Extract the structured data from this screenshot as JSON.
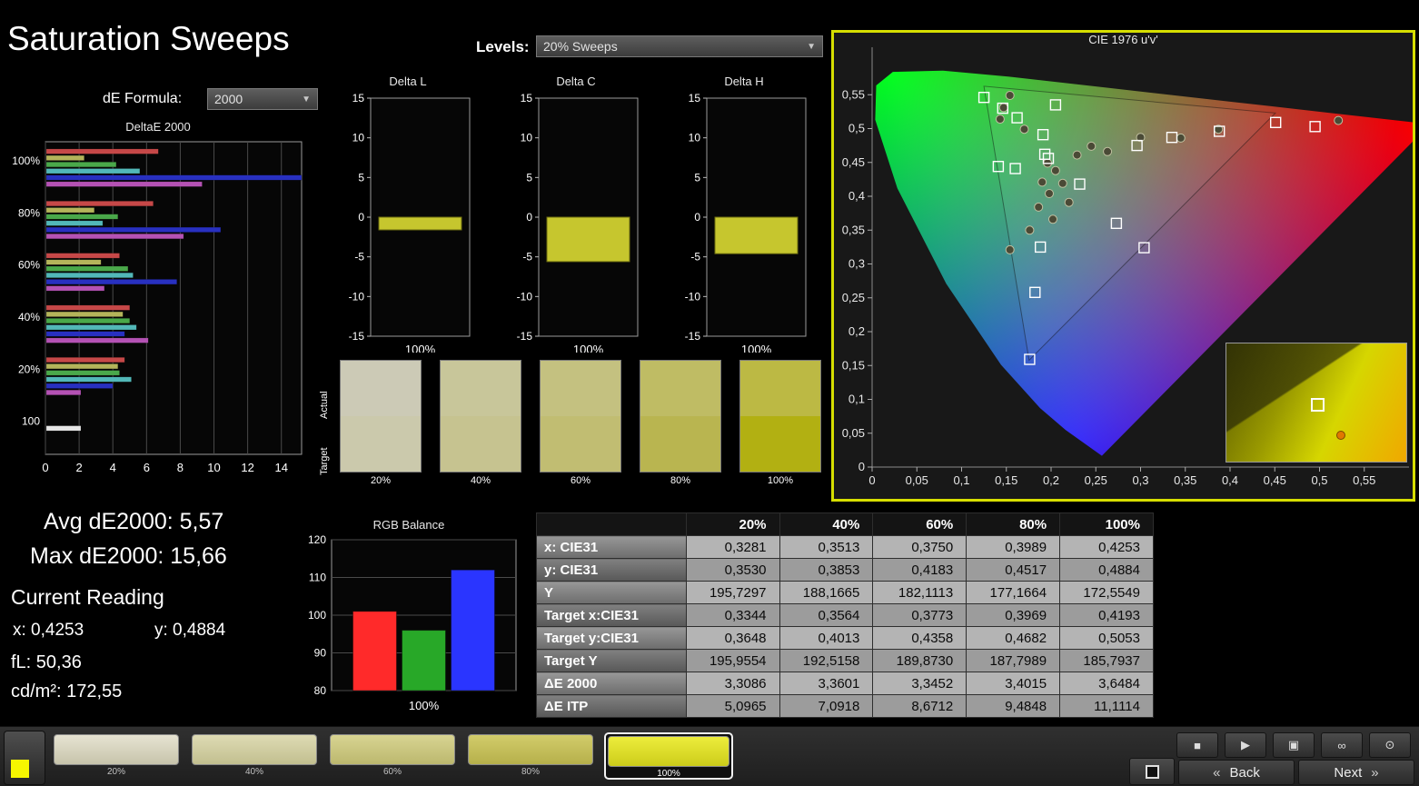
{
  "page": {
    "title": "Saturation Sweeps"
  },
  "controls": {
    "levels_label": "Levels:",
    "levels_value": "20% Sweeps",
    "de_formula_label": "dE Formula:",
    "de_formula_value": "2000"
  },
  "stats": {
    "avg": "Avg dE2000: 5,57",
    "max": "Max dE2000: 15,66",
    "current_reading_label": "Current Reading",
    "x": "x: 0,4253",
    "y": "y: 0,4884",
    "fl": "fL: 50,36",
    "cdm2": "cd/m²: 172,55"
  },
  "table": {
    "columns": [
      "20%",
      "40%",
      "60%",
      "80%",
      "100%"
    ],
    "rows": [
      {
        "label": "x: CIE31",
        "values": [
          "0,3281",
          "0,3513",
          "0,3750",
          "0,3989",
          "0,4253"
        ]
      },
      {
        "label": "y: CIE31",
        "values": [
          "0,3530",
          "0,3853",
          "0,4183",
          "0,4517",
          "0,4884"
        ]
      },
      {
        "label": "Y",
        "values": [
          "195,7297",
          "188,1665",
          "182,1113",
          "177,1664",
          "172,5549"
        ]
      },
      {
        "label": "Target x:CIE31",
        "values": [
          "0,3344",
          "0,3564",
          "0,3773",
          "0,3969",
          "0,4193"
        ]
      },
      {
        "label": "Target y:CIE31",
        "values": [
          "0,3648",
          "0,4013",
          "0,4358",
          "0,4682",
          "0,5053"
        ]
      },
      {
        "label": "Target Y",
        "values": [
          "195,9554",
          "192,5158",
          "189,8730",
          "187,7989",
          "185,7937"
        ]
      },
      {
        "label": "ΔE 2000",
        "values": [
          "3,3086",
          "3,3601",
          "3,3452",
          "3,4015",
          "3,6484"
        ]
      },
      {
        "label": "ΔE ITP",
        "values": [
          "5,0965",
          "7,0918",
          "8,6712",
          "9,4848",
          "11,1114"
        ]
      }
    ]
  },
  "swatch_strip": {
    "row_labels": [
      "Actual",
      "Target"
    ],
    "columns": [
      {
        "label": "20%",
        "actual": "#cccab6",
        "target": "#cbc9ac"
      },
      {
        "label": "40%",
        "actual": "#c8c69a",
        "target": "#c6c390"
      },
      {
        "label": "60%",
        "actual": "#c4c180",
        "target": "#c1bd72"
      },
      {
        "label": "80%",
        "actual": "#bfbc64",
        "target": "#b9b550"
      },
      {
        "label": "100%",
        "actual": "#bcb944",
        "target": "#b2b012"
      }
    ]
  },
  "chart_data": [
    {
      "id": "deltaE2000",
      "type": "bar",
      "orientation": "horizontal",
      "title": "DeltaE 2000",
      "categories": [
        "100%",
        "80%",
        "60%",
        "40%",
        "20%",
        "100"
      ],
      "series": [
        {
          "name": "red",
          "color": "#c64848",
          "values": [
            6.7,
            6.4,
            4.4,
            5.0,
            4.7,
            0
          ]
        },
        {
          "name": "yellow",
          "color": "#b4b45a",
          "values": [
            2.3,
            2.9,
            3.3,
            4.6,
            4.3,
            0
          ]
        },
        {
          "name": "green",
          "color": "#4aa84a",
          "values": [
            4.2,
            4.3,
            4.9,
            5.0,
            4.4,
            0
          ]
        },
        {
          "name": "cyan",
          "color": "#52b8b8",
          "values": [
            5.6,
            3.4,
            5.2,
            5.4,
            5.1,
            0
          ]
        },
        {
          "name": "blue",
          "color": "#2830c0",
          "values": [
            15.7,
            10.4,
            7.8,
            4.7,
            4.0,
            0
          ]
        },
        {
          "name": "magenta",
          "color": "#b452b4",
          "values": [
            9.3,
            8.2,
            3.5,
            6.1,
            2.1,
            0
          ]
        },
        {
          "name": "white",
          "color": "#e6e6e6",
          "values": [
            0,
            0,
            0,
            0,
            0,
            2.1
          ]
        }
      ],
      "xlim": [
        0,
        15.2
      ],
      "xticks": [
        0,
        2,
        4,
        6,
        8,
        10,
        12,
        14
      ]
    },
    {
      "id": "deltaL",
      "type": "bar",
      "title": "Delta L",
      "value": -1.6,
      "ylim": [
        -15,
        15
      ],
      "yticks": [
        15,
        10,
        5,
        0,
        -5,
        -10,
        -15
      ],
      "xlabel": "100%",
      "bar_color": "#c6c62e"
    },
    {
      "id": "deltaC",
      "type": "bar",
      "title": "Delta C",
      "value": -5.6,
      "ylim": [
        -15,
        15
      ],
      "yticks": [
        15,
        10,
        5,
        0,
        -5,
        -10,
        -15
      ],
      "xlabel": "100%",
      "bar_color": "#c6c62e"
    },
    {
      "id": "deltaH",
      "type": "bar",
      "title": "Delta H",
      "value": -4.6,
      "ylim": [
        -15,
        15
      ],
      "yticks": [
        15,
        10,
        5,
        0,
        -5,
        -10,
        -15
      ],
      "xlabel": "100%",
      "bar_color": "#c6c62e"
    },
    {
      "id": "rgbBalance",
      "type": "bar",
      "title": "RGB Balance",
      "categories": [
        "R",
        "G",
        "B"
      ],
      "values": [
        101,
        96,
        112
      ],
      "colors": [
        "#ff2a2a",
        "#28a828",
        "#2a35ff"
      ],
      "ylim": [
        80,
        120
      ],
      "yticks": [
        120,
        110,
        100,
        90,
        80
      ],
      "xlabel": "100%"
    },
    {
      "id": "cie",
      "type": "scatter",
      "title": "CIE 1976 u'v'",
      "xlim": [
        0,
        0.6
      ],
      "ylim": [
        0,
        0.62
      ],
      "xtick_labels": [
        "0",
        "0,05",
        "0,1",
        "0,15",
        "0,2",
        "0,25",
        "0,3",
        "0,35",
        "0,4",
        "0,45",
        "0,5",
        "0,55"
      ],
      "ytick_labels": [
        "0",
        "0,05",
        "0,1",
        "0,15",
        "0,2",
        "0,25",
        "0,3",
        "0,35",
        "0,4",
        "0,45",
        "0,5",
        "0,55"
      ],
      "tick_step": 0.05,
      "locus": [
        [
          0.2568,
          0.0166
        ],
        [
          0.2161,
          0.0549
        ],
        [
          0.1877,
          0.0871
        ],
        [
          0.1441,
          0.151
        ],
        [
          0.0828,
          0.2708
        ],
        [
          0.0282,
          0.4117
        ],
        [
          0.0035,
          0.5131
        ],
        [
          0.0046,
          0.5638
        ],
        [
          0.0231,
          0.5837
        ],
        [
          0.0792,
          0.5856
        ],
        [
          0.1531,
          0.5766
        ],
        [
          0.2623,
          0.5604
        ],
        [
          0.4035,
          0.5393
        ],
        [
          0.5203,
          0.5219
        ],
        [
          0.6234,
          0.5065
        ]
      ],
      "gamut_triangle": [
        [
          0.4507,
          0.5229
        ],
        [
          0.125,
          0.5625
        ],
        [
          0.1754,
          0.1579
        ]
      ],
      "targets": [
        [
          0.125,
          0.546
        ],
        [
          0.146,
          0.53
        ],
        [
          0.162,
          0.516
        ],
        [
          0.191,
          0.491
        ],
        [
          0.205,
          0.535
        ],
        [
          0.451,
          0.509
        ],
        [
          0.495,
          0.503
        ],
        [
          0.388,
          0.496
        ],
        [
          0.335,
          0.487
        ],
        [
          0.296,
          0.475
        ],
        [
          0.232,
          0.418
        ],
        [
          0.273,
          0.36
        ],
        [
          0.304,
          0.324
        ],
        [
          0.141,
          0.444
        ],
        [
          0.16,
          0.441
        ],
        [
          0.197,
          0.456
        ],
        [
          0.193,
          0.462
        ],
        [
          0.188,
          0.325
        ],
        [
          0.182,
          0.258
        ],
        [
          0.176,
          0.159
        ]
      ],
      "measurements": [
        [
          0.154,
          0.549
        ],
        [
          0.147,
          0.531
        ],
        [
          0.143,
          0.514
        ],
        [
          0.17,
          0.499
        ],
        [
          0.196,
          0.449
        ],
        [
          0.205,
          0.438
        ],
        [
          0.213,
          0.419
        ],
        [
          0.19,
          0.421
        ],
        [
          0.198,
          0.404
        ],
        [
          0.22,
          0.391
        ],
        [
          0.186,
          0.384
        ],
        [
          0.202,
          0.366
        ],
        [
          0.176,
          0.35
        ],
        [
          0.154,
          0.321
        ],
        [
          0.229,
          0.461
        ],
        [
          0.263,
          0.466
        ],
        [
          0.245,
          0.474
        ],
        [
          0.3,
          0.487
        ],
        [
          0.345,
          0.486
        ],
        [
          0.387,
          0.499
        ],
        [
          0.521,
          0.512
        ]
      ],
      "inset": {
        "square": [
          0.47,
          0.46
        ],
        "dot": [
          0.61,
          0.74
        ]
      }
    }
  ],
  "footer": {
    "levels": [
      {
        "label": "20%",
        "top": "#e6e3d2",
        "bottom": "#c7c4ab",
        "selected": false
      },
      {
        "label": "40%",
        "top": "#dedbb4",
        "bottom": "#c2bf8f",
        "selected": false
      },
      {
        "label": "60%",
        "top": "#d8d492",
        "bottom": "#bcb86e",
        "selected": false
      },
      {
        "label": "80%",
        "top": "#d2cc6b",
        "bottom": "#b6b04b",
        "selected": false
      },
      {
        "label": "100%",
        "top": "#eded3c",
        "bottom": "#cccc1a",
        "selected": true
      }
    ],
    "transport": [
      {
        "name": "stop",
        "icon": "■"
      },
      {
        "name": "play",
        "icon": "▶"
      },
      {
        "name": "record",
        "icon": "▣"
      },
      {
        "name": "loop",
        "icon": "∞"
      },
      {
        "name": "view",
        "icon": "⊙"
      }
    ],
    "back_chevron": "«",
    "back_label": "Back",
    "next_label": "Next",
    "next_chevron": "»"
  }
}
